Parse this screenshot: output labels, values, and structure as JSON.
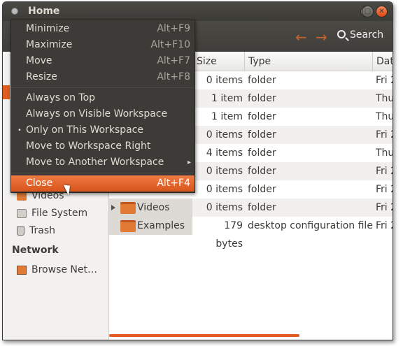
{
  "window": {
    "title": "Home",
    "minimize_icon": "minimize-icon",
    "maximize_icon": "maximize-icon",
    "close_icon": "close-icon"
  },
  "toolbar": {
    "back_icon": "arrow-left-icon",
    "forward_icon": "arrow-right-icon",
    "search_label": "Search"
  },
  "sidebar": {
    "items": [
      {
        "label": "Videos",
        "icon": "videos-folder-icon"
      },
      {
        "label": "File System",
        "icon": "drive-icon"
      },
      {
        "label": "Trash",
        "icon": "trash-icon"
      }
    ],
    "network_heading": "Network",
    "network_items": [
      {
        "label": "Browse Net…",
        "icon": "network-icon"
      }
    ]
  },
  "columns": {
    "size": "Size",
    "type": "Type",
    "date": "Dat"
  },
  "rows": [
    {
      "name": "",
      "size": "0 items",
      "type": "folder",
      "date": "Fri 2"
    },
    {
      "name": "",
      "size": "1 item",
      "type": "folder",
      "date": "Thu"
    },
    {
      "name": "",
      "size": "1 item",
      "type": "folder",
      "date": "Thu"
    },
    {
      "name": "",
      "size": "0 items",
      "type": "folder",
      "date": "Fri 2"
    },
    {
      "name": "",
      "size": "4 items",
      "type": "folder",
      "date": "Thu"
    },
    {
      "name": "",
      "size": "0 items",
      "type": "folder",
      "date": "Fri 2"
    },
    {
      "name": "",
      "size": "0 items",
      "type": "folder",
      "date": "Fri 2"
    },
    {
      "name": "Videos",
      "size": "0 items",
      "type": "folder",
      "date": "Fri 2"
    },
    {
      "name": "Examples",
      "size": "179 bytes",
      "type": "desktop configuration file",
      "date": "Fri 2"
    }
  ],
  "menu": {
    "items": [
      {
        "label": "Minimize",
        "accel": "Alt+F9"
      },
      {
        "label": "Maximize",
        "accel": "Alt+F10"
      },
      {
        "label": "Move",
        "accel": "Alt+F7"
      },
      {
        "label": "Resize",
        "accel": "Alt+F8"
      },
      {
        "label": "Always on Top",
        "accel": ""
      },
      {
        "label": "Always on Visible Workspace",
        "accel": ""
      },
      {
        "label": "Only on This Workspace",
        "accel": "",
        "bullet": "•"
      },
      {
        "label": "Move to Workspace Right",
        "accel": ""
      },
      {
        "label": "Move to Another Workspace",
        "accel": "",
        "submenu": "▸"
      },
      {
        "label": "Close",
        "accel": "Alt+F4"
      }
    ]
  },
  "colors": {
    "accent": "#dd4814",
    "titlebar": "#3c3b37"
  }
}
